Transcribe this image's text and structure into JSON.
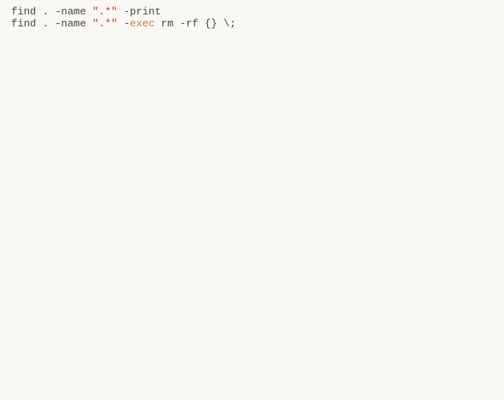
{
  "lines": [
    {
      "tokens": [
        {
          "cls": "tok-default",
          "text": "find "
        },
        {
          "cls": "tok-default",
          "text": ". "
        },
        {
          "cls": "tok-default",
          "text": "-name "
        },
        {
          "cls": "tok-literal-string",
          "text": "\".*\""
        },
        {
          "cls": "tok-default",
          "text": " -print"
        }
      ]
    },
    {
      "tokens": [
        {
          "cls": "tok-default",
          "text": "find "
        },
        {
          "cls": "tok-default",
          "text": ". "
        },
        {
          "cls": "tok-default",
          "text": "-name "
        },
        {
          "cls": "tok-literal-string",
          "text": "\".*\""
        },
        {
          "cls": "tok-default",
          "text": " -"
        },
        {
          "cls": "tok-keyword",
          "text": "exec"
        },
        {
          "cls": "tok-default",
          "text": " rm "
        },
        {
          "cls": "tok-default",
          "text": "-rf "
        },
        {
          "cls": "tok-default",
          "text": "{} "
        },
        {
          "cls": "tok-default",
          "text": "\\;"
        }
      ]
    }
  ]
}
